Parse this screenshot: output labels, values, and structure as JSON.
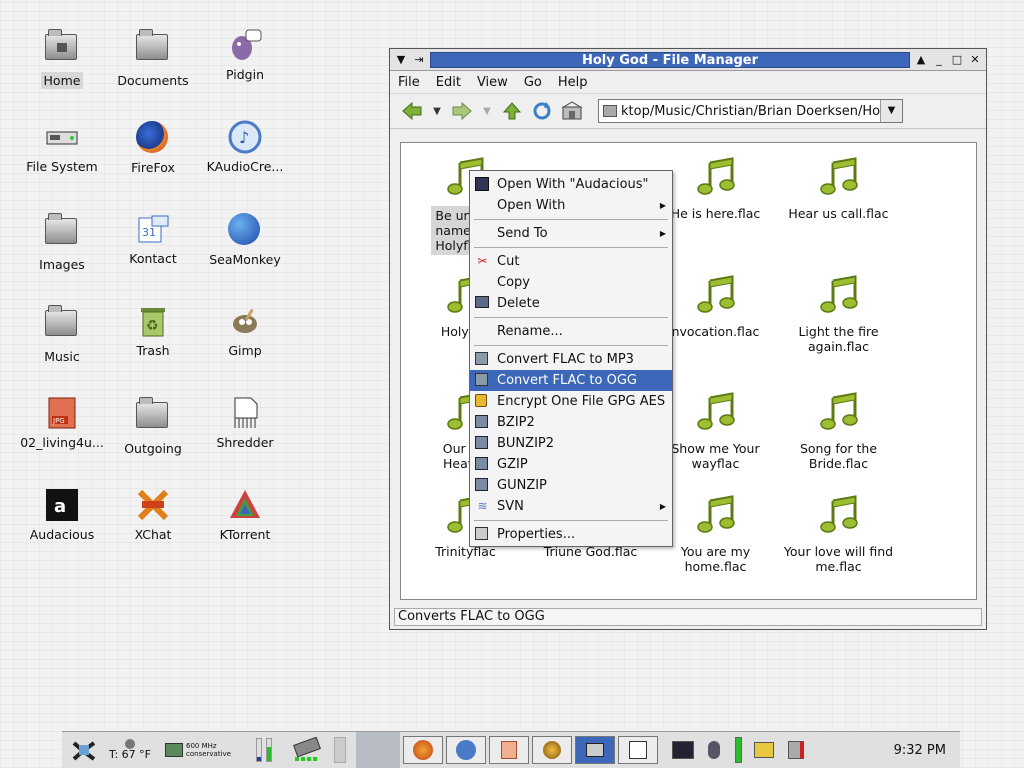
{
  "desktop": {
    "icons": [
      {
        "label": "Home",
        "icon": "home-folder-icon"
      },
      {
        "label": "Documents",
        "icon": "folder-icon"
      },
      {
        "label": "Pidgin",
        "icon": "pidgin-icon"
      },
      {
        "label": "File System",
        "icon": "drive-icon"
      },
      {
        "label": "FireFox",
        "icon": "firefox-icon"
      },
      {
        "label": "KAudioCre...",
        "icon": "kaudiocreator-icon"
      },
      {
        "label": "Images",
        "icon": "folder-icon"
      },
      {
        "label": "Kontact",
        "icon": "kontact-icon"
      },
      {
        "label": "SeaMonkey",
        "icon": "seamonkey-icon"
      },
      {
        "label": "Music",
        "icon": "folder-icon"
      },
      {
        "label": "Trash",
        "icon": "trash-icon"
      },
      {
        "label": "Gimp",
        "icon": "gimp-icon"
      },
      {
        "label": "02_living4u...",
        "icon": "jpg-icon"
      },
      {
        "label": "Outgoing",
        "icon": "folder-icon"
      },
      {
        "label": "Shredder",
        "icon": "shredder-icon"
      },
      {
        "label": "Audacious",
        "icon": "audacious-icon"
      },
      {
        "label": "XChat",
        "icon": "xchat-icon"
      },
      {
        "label": "KTorrent",
        "icon": "ktorrent-icon"
      }
    ]
  },
  "window": {
    "title": "Holy God - File Manager",
    "menu": [
      "File",
      "Edit",
      "View",
      "Go",
      "Help"
    ],
    "location": "ktop/Music/Christian/Brian Doerksen/Holy God",
    "status": "Converts FLAC to OGG",
    "files": [
      {
        "name": "Be unto Your name - Holy Holy.flac",
        "display": "Be unto Y\nname - H\nHolyflac"
      },
      {
        "name": "",
        "display": ""
      },
      {
        "name": "He is here.flac",
        "display": "He is here.flac"
      },
      {
        "name": "Hear us call.flac",
        "display": "Hear us call.flac"
      },
      {
        "name": "Holy God",
        "display": "Holy Go"
      },
      {
        "name": "",
        "display": ""
      },
      {
        "name": "Invocation.flac",
        "display": "nvocation.flac"
      },
      {
        "name": "Light the fire again.flac",
        "display": "Light the fire\nagain.flac"
      },
      {
        "name": "Our Father in Heaven",
        "display": "Our Fat\nHeaver"
      },
      {
        "name": "",
        "display": ""
      },
      {
        "name": "Show me Your way.flac",
        "display": "Show me Your\nwayflac"
      },
      {
        "name": "Song for the Bride.flac",
        "display": "Song for the\nBride.flac"
      },
      {
        "name": "Trinity.flac",
        "display": "Trinityflac"
      },
      {
        "name": "Triune God.flac",
        "display": "Triune God.flac"
      },
      {
        "name": "You are my home.flac",
        "display": "You are my\nhome.flac"
      },
      {
        "name": "Your love will find me.flac",
        "display": "Your love will find\nme.flac"
      }
    ]
  },
  "context_menu": {
    "items": [
      {
        "label": "Open With \"Audacious\"",
        "icon": "audacious-icon",
        "submenu": false
      },
      {
        "label": "Open With",
        "icon": "",
        "submenu": true
      },
      {
        "sep": true
      },
      {
        "label": "Send To",
        "icon": "",
        "submenu": true
      },
      {
        "sep": true
      },
      {
        "label": "Cut",
        "icon": "scissors-icon",
        "submenu": false
      },
      {
        "label": "Copy",
        "icon": "",
        "submenu": false
      },
      {
        "label": "Delete",
        "icon": "delete-icon",
        "submenu": false
      },
      {
        "sep": true
      },
      {
        "label": "Rename...",
        "icon": "",
        "submenu": false
      },
      {
        "sep": true
      },
      {
        "label": "Convert FLAC to MP3",
        "icon": "script-icon",
        "submenu": false
      },
      {
        "label": "Convert FLAC to OGG",
        "icon": "script-icon",
        "submenu": false,
        "highlighted": true
      },
      {
        "label": "Encrypt One File GPG AES",
        "icon": "lock-icon",
        "submenu": false
      },
      {
        "label": "BZIP2",
        "icon": "archive-icon",
        "submenu": false
      },
      {
        "label": "BUNZIP2",
        "icon": "archive-icon",
        "submenu": false
      },
      {
        "label": "GZIP",
        "icon": "archive-icon",
        "submenu": false
      },
      {
        "label": "GUNZIP",
        "icon": "archive-icon",
        "submenu": false
      },
      {
        "label": "SVN",
        "icon": "svn-icon",
        "submenu": true
      },
      {
        "sep": true
      },
      {
        "label": "Properties...",
        "icon": "properties-icon",
        "submenu": false
      }
    ]
  },
  "taskbar": {
    "temperature": "T: 67 °F",
    "cpu_speed": "600 MHz",
    "cpu_governor": "conservative",
    "clock": "9:32 PM"
  },
  "colors": {
    "accent": "#3d67b8",
    "music_note": "#8cab2c"
  }
}
